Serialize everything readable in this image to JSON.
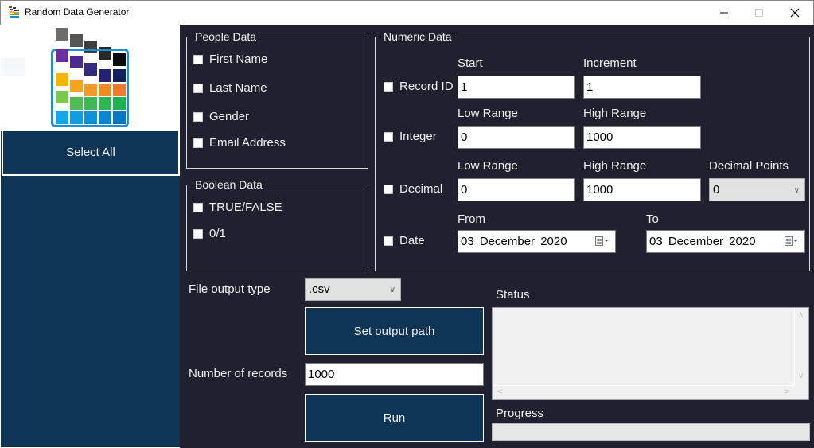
{
  "window": {
    "title": "Random Data Generator",
    "controls": {
      "minimize": "—",
      "maximize": "☐",
      "close": "✕"
    }
  },
  "sidebar": {
    "logo_icon": "data-grid-logo",
    "select_all_label": "Select All"
  },
  "people_data": {
    "legend": "People Data",
    "items": [
      {
        "label": "First Name",
        "checked": false
      },
      {
        "label": "Last Name",
        "checked": false
      },
      {
        "label": "Gender",
        "checked": false
      },
      {
        "label": "Email Address",
        "checked": false
      }
    ]
  },
  "boolean_data": {
    "legend": "Boolean Data",
    "items": [
      {
        "label": "TRUE/FALSE",
        "checked": false
      },
      {
        "label": "0/1",
        "checked": false
      }
    ]
  },
  "numeric_data": {
    "legend": "Numeric Data",
    "record_id": {
      "label": "Record ID",
      "checked": false,
      "start_label": "Start",
      "start_value": "1",
      "increment_label": "Increment",
      "increment_value": "1"
    },
    "integer": {
      "label": "Integer",
      "checked": false,
      "low_label": "Low Range",
      "low_value": "0",
      "high_label": "High Range",
      "high_value": "1000"
    },
    "decimal": {
      "label": "Decimal",
      "checked": false,
      "low_label": "Low Range",
      "low_value": "0",
      "high_label": "High Range",
      "high_value": "1000",
      "points_label": "Decimal Points",
      "points_value": "0"
    },
    "date": {
      "label": "Date",
      "checked": false,
      "from_label": "From",
      "from_value": "03  December  2020",
      "to_label": "To",
      "to_value": "03  December  2020"
    }
  },
  "output": {
    "file_type_label": "File output type",
    "file_type_value": ".csv",
    "set_path_label": "Set output path",
    "records_label": "Number of records",
    "records_value": "1000",
    "run_label": "Run"
  },
  "status": {
    "label": "Status",
    "text": ""
  },
  "progress": {
    "label": "Progress",
    "percent": 0
  },
  "colors": {
    "sidebar": "#0f3556",
    "background": "#21202e",
    "button": "#0f3556"
  }
}
